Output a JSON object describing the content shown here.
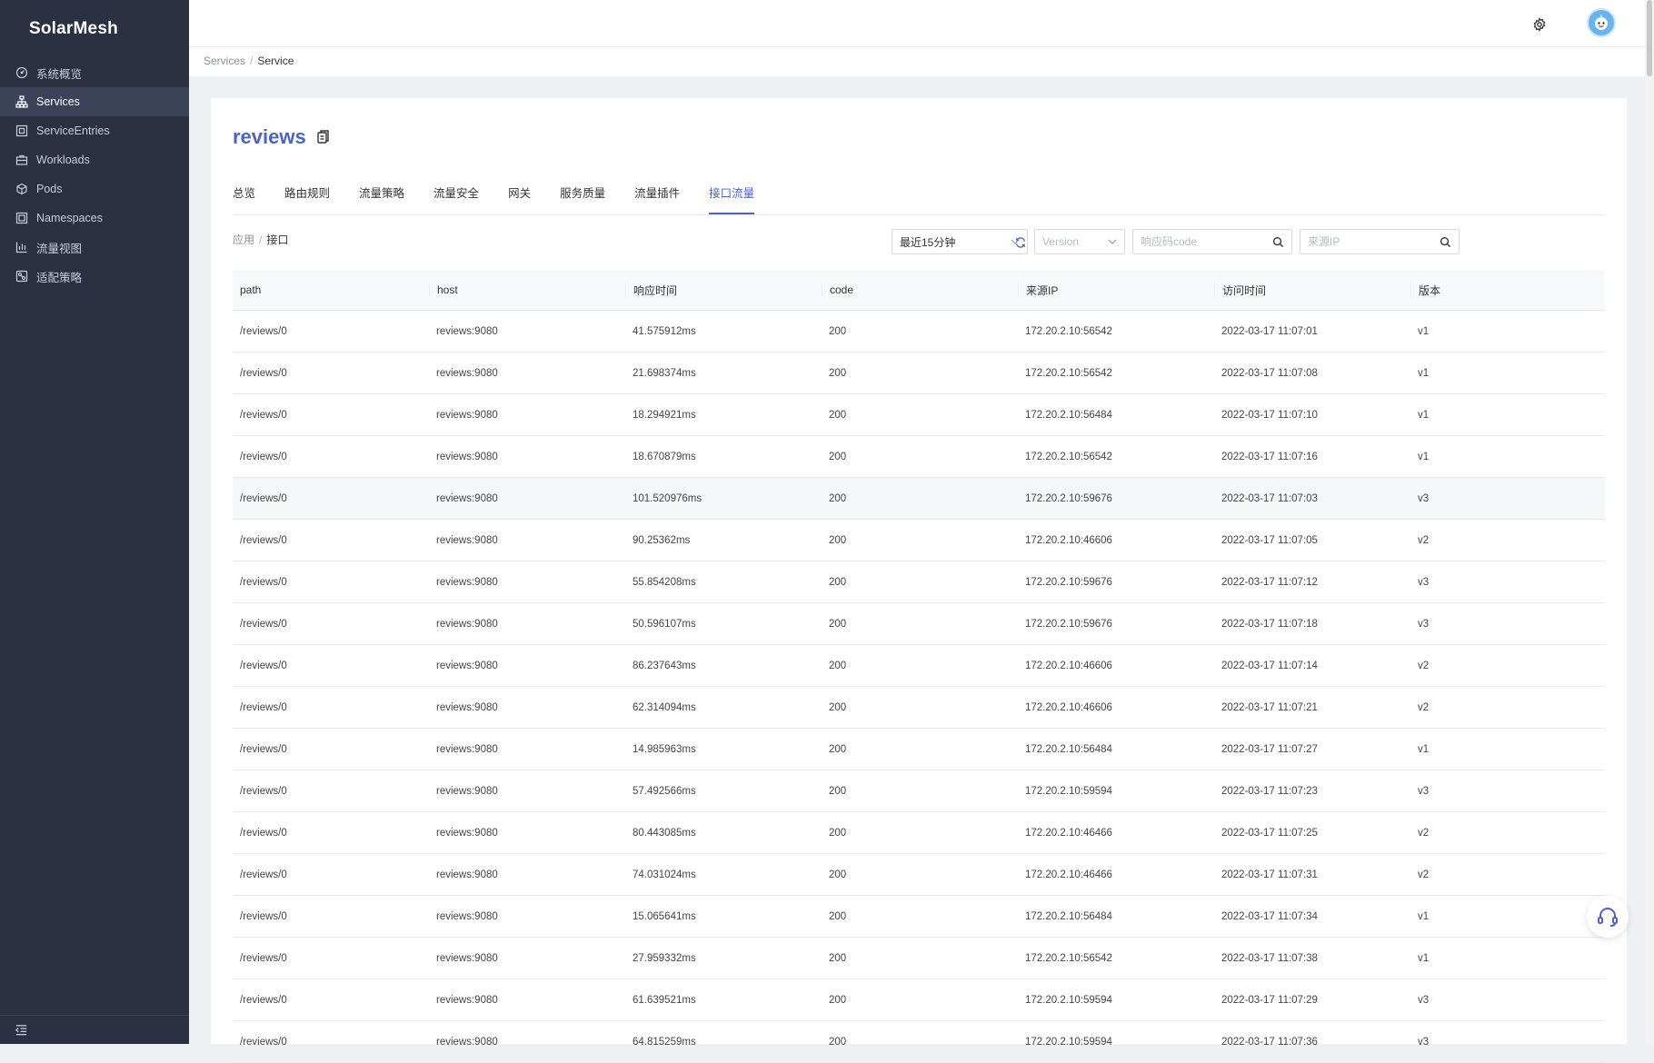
{
  "app": {
    "brand": "SolarMesh"
  },
  "sidebar": {
    "items": [
      {
        "label": "系统概览",
        "icon": "dashboard-icon",
        "active": false
      },
      {
        "label": "Services",
        "icon": "sitemap-icon",
        "active": true
      },
      {
        "label": "ServiceEntries",
        "icon": "entry-icon",
        "active": false
      },
      {
        "label": "Workloads",
        "icon": "briefcase-icon",
        "active": false
      },
      {
        "label": "Pods",
        "icon": "cube-icon",
        "active": false
      },
      {
        "label": "Namespaces",
        "icon": "namespace-icon",
        "active": false
      },
      {
        "label": "流量视图",
        "icon": "bar-chart-icon",
        "active": false
      },
      {
        "label": "适配策略",
        "icon": "policy-icon",
        "active": false
      }
    ]
  },
  "breadcrumb": {
    "parent": "Services",
    "separator": "/",
    "current": "Service"
  },
  "service": {
    "name": "reviews"
  },
  "tabs": [
    {
      "label": "总览",
      "active": false
    },
    {
      "label": "路由规则",
      "active": false
    },
    {
      "label": "流量策略",
      "active": false
    },
    {
      "label": "流量安全",
      "active": false
    },
    {
      "label": "网关",
      "active": false
    },
    {
      "label": "服务质量",
      "active": false
    },
    {
      "label": "流量插件",
      "active": false
    },
    {
      "label": "接口流量",
      "active": true
    }
  ],
  "subcrumb": {
    "parent": "应用",
    "separator": "/",
    "current": "接口"
  },
  "filters": {
    "time_range": "最近15分钟",
    "version_placeholder": "Version",
    "code_placeholder": "响应码code",
    "ip_placeholder": "来源IP"
  },
  "table": {
    "columns": [
      "path",
      "host",
      "响应时间",
      "code",
      "来源IP",
      "访问时间",
      "版本"
    ],
    "rows": [
      [
        "/reviews/0",
        "reviews:9080",
        "41.575912ms",
        "200",
        "172.20.2.10:56542",
        "2022-03-17 11:07:01",
        "v1"
      ],
      [
        "/reviews/0",
        "reviews:9080",
        "21.698374ms",
        "200",
        "172.20.2.10:56542",
        "2022-03-17 11:07:08",
        "v1"
      ],
      [
        "/reviews/0",
        "reviews:9080",
        "18.294921ms",
        "200",
        "172.20.2.10:56484",
        "2022-03-17 11:07:10",
        "v1"
      ],
      [
        "/reviews/0",
        "reviews:9080",
        "18.670879ms",
        "200",
        "172.20.2.10:56542",
        "2022-03-17 11:07:16",
        "v1"
      ],
      [
        "/reviews/0",
        "reviews:9080",
        "101.520976ms",
        "200",
        "172.20.2.10:59676",
        "2022-03-17 11:07:03",
        "v3"
      ],
      [
        "/reviews/0",
        "reviews:9080",
        "90.25362ms",
        "200",
        "172.20.2.10:46606",
        "2022-03-17 11:07:05",
        "v2"
      ],
      [
        "/reviews/0",
        "reviews:9080",
        "55.854208ms",
        "200",
        "172.20.2.10:59676",
        "2022-03-17 11:07:12",
        "v3"
      ],
      [
        "/reviews/0",
        "reviews:9080",
        "50.596107ms",
        "200",
        "172.20.2.10:59676",
        "2022-03-17 11:07:18",
        "v3"
      ],
      [
        "/reviews/0",
        "reviews:9080",
        "86.237643ms",
        "200",
        "172.20.2.10:46606",
        "2022-03-17 11:07:14",
        "v2"
      ],
      [
        "/reviews/0",
        "reviews:9080",
        "62.314094ms",
        "200",
        "172.20.2.10:46606",
        "2022-03-17 11:07:21",
        "v2"
      ],
      [
        "/reviews/0",
        "reviews:9080",
        "14.985963ms",
        "200",
        "172.20.2.10:56484",
        "2022-03-17 11:07:27",
        "v1"
      ],
      [
        "/reviews/0",
        "reviews:9080",
        "57.492566ms",
        "200",
        "172.20.2.10:59594",
        "2022-03-17 11:07:23",
        "v3"
      ],
      [
        "/reviews/0",
        "reviews:9080",
        "80.443085ms",
        "200",
        "172.20.2.10:46466",
        "2022-03-17 11:07:25",
        "v2"
      ],
      [
        "/reviews/0",
        "reviews:9080",
        "74.031024ms",
        "200",
        "172.20.2.10:46466",
        "2022-03-17 11:07:31",
        "v2"
      ],
      [
        "/reviews/0",
        "reviews:9080",
        "15.065641ms",
        "200",
        "172.20.2.10:56484",
        "2022-03-17 11:07:34",
        "v1"
      ],
      [
        "/reviews/0",
        "reviews:9080",
        "27.959332ms",
        "200",
        "172.20.2.10:56542",
        "2022-03-17 11:07:38",
        "v1"
      ],
      [
        "/reviews/0",
        "reviews:9080",
        "61.639521ms",
        "200",
        "172.20.2.10:59594",
        "2022-03-17 11:07:29",
        "v3"
      ],
      [
        "/reviews/0",
        "reviews:9080",
        "64.815259ms",
        "200",
        "172.20.2.10:59594",
        "2022-03-17 11:07:36",
        "v3"
      ]
    ]
  },
  "colors": {
    "sidebar_bg": "#2b3142",
    "sidebar_active": "#3c4358",
    "accent": "#4b63c9",
    "avatar": "#6ab4ee"
  }
}
